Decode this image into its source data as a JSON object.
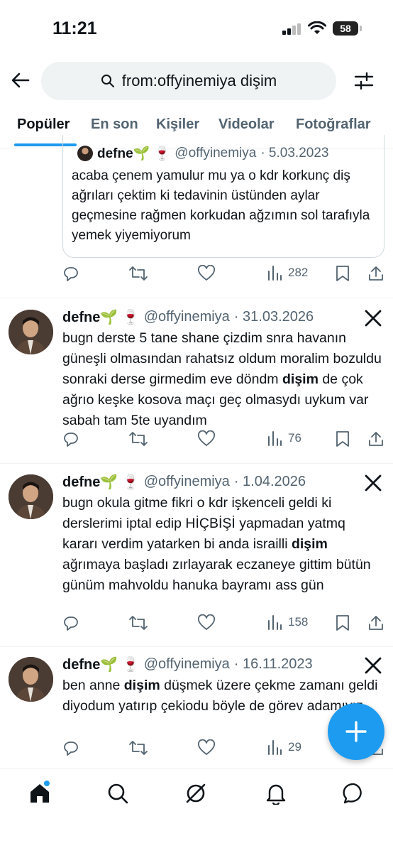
{
  "status_bar": {
    "time": "11:21",
    "battery": "58"
  },
  "search": {
    "query": "from:offyinemiya dişim"
  },
  "tabs": [
    {
      "label": "Popüler"
    },
    {
      "label": "En son"
    },
    {
      "label": "Kişiler"
    },
    {
      "label": "Videolar"
    },
    {
      "label": "Fotoğraflar"
    }
  ],
  "quoted": {
    "name": "defne🌱 🍷",
    "handle": "@offyinemiya",
    "date": "· 5.03.2023",
    "text": "acaba çenem yamulur mu ya o kdr korkunç diş ağrıları çektim ki tedavinin üstünden aylar geçmesine rağmen  korkudan ağzımın sol tarafıyla yemek yiyemiyorum",
    "views": "282"
  },
  "tweets": [
    {
      "name": "defne🌱 🍷",
      "handle": "@offyinemiya",
      "date": "· 31.03.2026",
      "text_before": "bugn derste 5 tane shane çizdim snra havanın güneşli olmasından rahatsız oldum moralim bozuldu sonraki derse girmedim eve döndm ",
      "highlight": "dişim",
      "text_after": " de çok ağrıo keşke kosova maçı geç olmasydı uykum var sabah tam 5te uyandım",
      "views": "76"
    },
    {
      "name": "defne🌱 🍷",
      "handle": "@offyinemiya",
      "date": "· 1.04.2026",
      "text_before": "bugn okula gitme fikri o kdr işkenceli geldi ki derslerimi iptal edip HİÇBİŞİ yapmadan yatmq kararı verdim yatarken bi anda israilli ",
      "highlight": "dişim",
      "text_after": " ağrımaya başladı zırlayarak eczaneye gittim bütün günüm mahvoldu hanuka bayramı ass gün",
      "views": "158"
    },
    {
      "name": "defne🌱 🍷",
      "handle": "@offyinemiya",
      "date": "· 16.11.2023",
      "text_before": "ben anne ",
      "highlight": "dişim",
      "text_after": " düşmek üzere çekme zamanı geldi diyodum yatırıp çekiodu böyle de görev adamıyız",
      "views": "29"
    }
  ],
  "icons": {
    "back": "arrow-left-icon",
    "search": "search-icon",
    "filter": "filter-sliders-icon",
    "reply": "reply-icon",
    "retweet": "retweet-icon",
    "like": "heart-icon",
    "views": "views-bar-icon",
    "bookmark": "bookmark-icon",
    "share": "share-icon",
    "x_logo": "x-logo-icon",
    "compose": "plus-icon",
    "home": "home-icon",
    "explore": "search-icon",
    "grok": "grok-icon",
    "notifications": "bell-icon",
    "messages": "chat-bubble-icon"
  },
  "colors": {
    "accent": "#1d9bf0",
    "text": "#0f1419",
    "muted": "#536471"
  }
}
